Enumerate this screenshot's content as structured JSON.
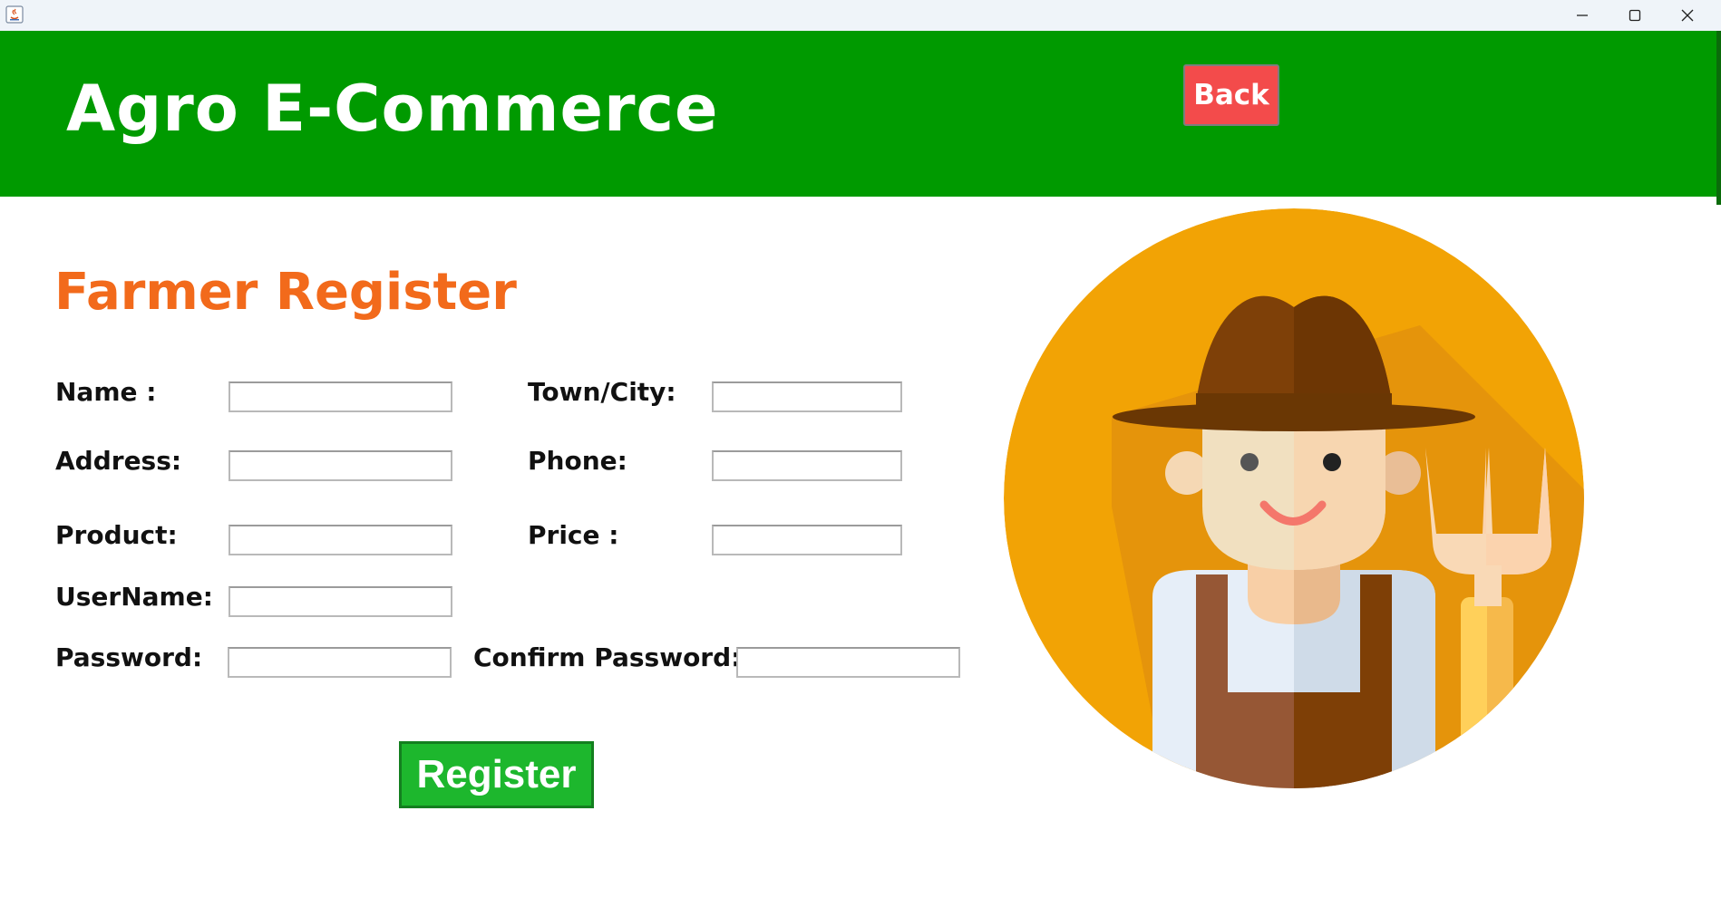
{
  "window": {
    "minimize_label": "Minimize",
    "maximize_label": "Maximize",
    "close_label": "Close",
    "app_icon": "java-icon"
  },
  "header": {
    "title": "Agro E-Commerce",
    "back_label": "Back",
    "background": "#009a00",
    "back_color": "#f34b4b"
  },
  "form": {
    "title": "Farmer Register",
    "title_color": "#f26a1b",
    "fields": {
      "name": {
        "label": "Name :",
        "value": ""
      },
      "town_city": {
        "label": "Town/City:",
        "value": ""
      },
      "address": {
        "label": "Address:",
        "value": ""
      },
      "phone": {
        "label": "Phone:",
        "value": ""
      },
      "product": {
        "label": "Product:",
        "value": ""
      },
      "price": {
        "label": "Price :",
        "value": ""
      },
      "username": {
        "label": "UserName:",
        "value": ""
      },
      "password": {
        "label": "Password:",
        "value": ""
      },
      "confirm_password": {
        "label": "Confirm Password:",
        "value": ""
      }
    },
    "register_label": "Register",
    "register_color": "#1db72d"
  },
  "illustration": {
    "icon": "farmer-avatar-icon",
    "background": "#f2a305"
  }
}
